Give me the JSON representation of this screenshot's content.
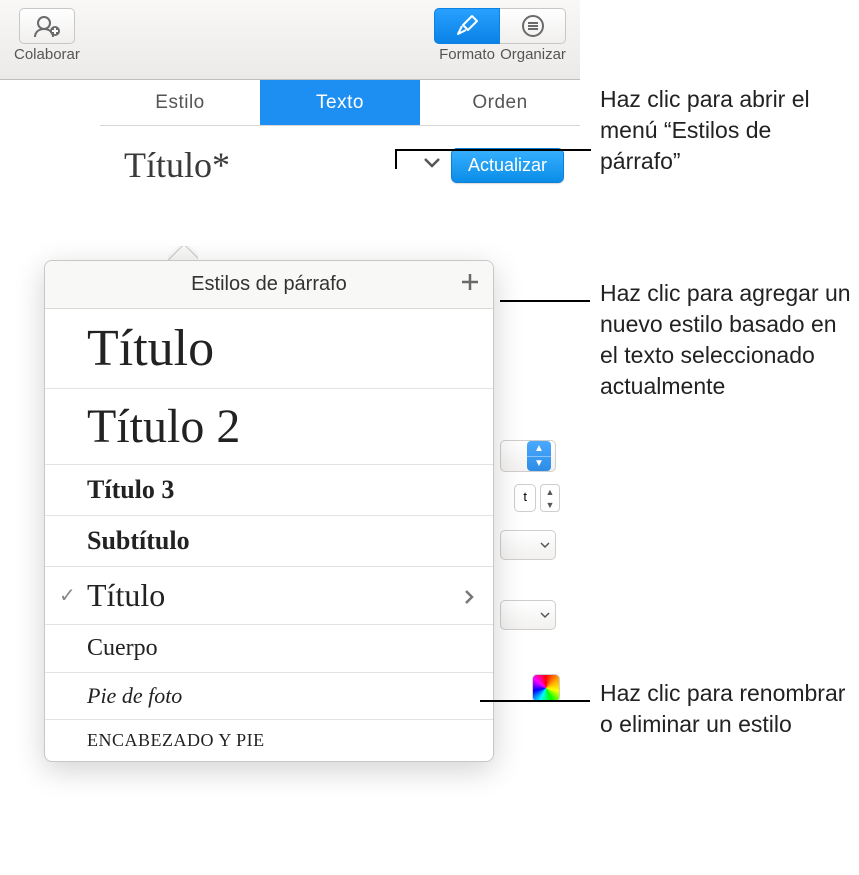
{
  "toolbar": {
    "collaborate_label": "Colaborar",
    "format_label": "Formato",
    "organize_label": "Organizar"
  },
  "tabs": {
    "style": "Estilo",
    "text": "Texto",
    "order": "Orden"
  },
  "style_row": {
    "name": "Título*",
    "update_label": "Actualizar"
  },
  "popover": {
    "header": "Estilos de párrafo",
    "items": [
      {
        "label": "Título",
        "variant": "titulo"
      },
      {
        "label": "Título 2",
        "variant": "titulo2"
      },
      {
        "label": "Título 3",
        "variant": "titulo3"
      },
      {
        "label": "Subtítulo",
        "variant": "subtitulo"
      },
      {
        "label": "Título",
        "variant": "titulo-sel",
        "selected": true,
        "has_chevron": true
      },
      {
        "label": "Cuerpo",
        "variant": "cuerpo"
      },
      {
        "label": "Pie de foto",
        "variant": "pie"
      },
      {
        "label": "ENCABEZADO Y PIE",
        "variant": "enc"
      }
    ]
  },
  "annotations": {
    "a1": "Haz clic para abrir el menú “Estilos de párrafo”",
    "a2": "Haz clic para agregar un nuevo estilo basado en el texto seleccionado actualmente",
    "a3": "Haz clic para renombrar o eliminar un estilo"
  },
  "icons": {
    "collaborate": "collaborate-icon",
    "paint": "paintbrush-icon",
    "organize": "list-icon",
    "plus": "plus-icon",
    "chevron_down": "chevron-down-icon",
    "chevron_right": "chevron-right-icon"
  }
}
